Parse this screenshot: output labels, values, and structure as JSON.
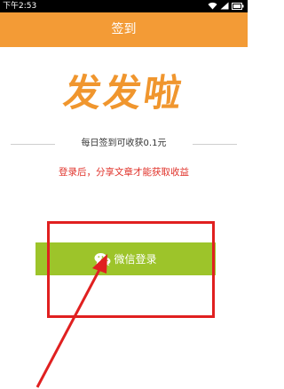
{
  "status_bar": {
    "time": "下午2:53",
    "icons": [
      "wifi-icon",
      "signal-icon",
      "battery-icon"
    ]
  },
  "header": {
    "title": "签到",
    "background": "#f39b36"
  },
  "brand": {
    "name": "发发啦",
    "color": "#f0962e"
  },
  "reward": {
    "text": "每日签到可收获0.1元"
  },
  "notice": {
    "text": "登录后，分享文章才能获取收益",
    "color": "#e0322a"
  },
  "login_button": {
    "label": "微信登录",
    "icon": "wechat-icon",
    "background": "#9dc42a"
  },
  "annotation": {
    "color": "#e02020"
  }
}
